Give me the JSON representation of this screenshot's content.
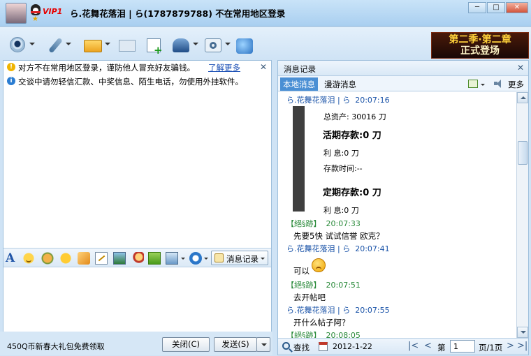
{
  "window": {
    "title": "ら.花舞花落泪 | ら(1787879788)  不在常用地区登录",
    "vip": "VIP1",
    "buttons": {
      "minimize": "─",
      "maximize": "□",
      "close": "✕"
    }
  },
  "toolbar": {
    "icons": [
      "webcam-icon",
      "microphone-icon",
      "folder-icon",
      "mail-icon",
      "note-add-icon",
      "hat-icon",
      "settings-icon",
      "app-icon"
    ],
    "banner": {
      "line1": "第二季·第二章",
      "line2": "正式登场"
    }
  },
  "notices": {
    "warning": "对方不在常用地区登录，谨防他人冒充好友骗钱。",
    "more_link": "了解更多",
    "info": "交谈中请勿轻信汇款、中奖信息、陌生电话，勿使用外挂软件。",
    "close": "✕"
  },
  "format_bar": {
    "font_label": "A",
    "message_record_button": "消息记录"
  },
  "bottom": {
    "promo": "450Q币新春大礼包免费领取",
    "close_button": "关闭(C)",
    "send_button": "发送(S)"
  },
  "history_panel": {
    "title": "消息记录",
    "close": "✕",
    "tabs": [
      "本地消息",
      "漫游消息"
    ],
    "more": "更多",
    "messages": [
      {
        "sender": "ら.花舞花落泪 | ら",
        "time": "20:07:16",
        "side": "me"
      },
      {
        "sender": "【絕§跡】",
        "time": "20:07:33",
        "side": "them",
        "text": "先要5快   试试信誉   欧克？"
      },
      {
        "sender": "ら.花舞花落泪 | ら",
        "time": "20:07:41",
        "side": "me",
        "text": "可以"
      },
      {
        "sender": "【絕§跡】",
        "time": "20:07:51",
        "side": "them",
        "text": "去开帖吧"
      },
      {
        "sender": "ら.花舞花落泪 | ら",
        "time": "20:07:55",
        "side": "me",
        "text": "开什么帖子阿？"
      },
      {
        "sender": "【絕§跡】",
        "time": "20:08:05",
        "side": "them"
      }
    ],
    "card": {
      "total_assets": "总资产: 30016 刀",
      "current_deposit": "活期存款:0 刀",
      "current_interest": "利   息:0 刀",
      "deposit_time": "存款时间:--",
      "fixed_deposit": "定期存款:0 刀",
      "fixed_interest": "利   息:0 刀"
    },
    "footer": {
      "find": "查找",
      "date": "2012-1-22",
      "page_prefix": "第",
      "page_value": "1",
      "page_suffix": "页/1页"
    }
  }
}
